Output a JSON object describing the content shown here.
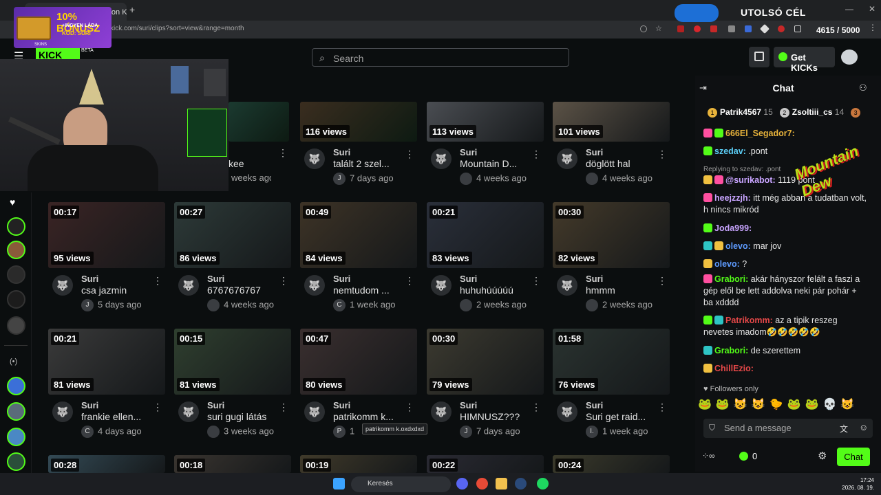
{
  "browser": {
    "tab_title": "Suri Clips - Watch Live on Kick",
    "url": "kick.com/suri/clips?sort=view&range=month",
    "new_tab": "+",
    "win_controls": [
      "—",
      "❐",
      "✕"
    ]
  },
  "overlay": {
    "banner_bonus": "10% BÓNUSZ",
    "banner_sub": "+INGYEN LÁDA",
    "banner_code": "KÓD: SURI",
    "banner_brand": "SKINS",
    "goal_label": "UTOLSÓ CÉL",
    "goal_value": "4615 / 5000",
    "brand_overlay": "Mountain Dew"
  },
  "header": {
    "logo": "KICK",
    "beta": "BETA",
    "search_placeholder": "Search",
    "get_kicks": "Get KICKs"
  },
  "clips": [
    {
      "duration": "",
      "views": "116 views",
      "author": "Suri",
      "title": "talált 2 szel...",
      "badge": "J",
      "ago": "7 days ago"
    },
    {
      "duration": "",
      "views": "113 views",
      "author": "Suri",
      "title": "Mountain D...",
      "badge": "",
      "ago": "4 weeks ago"
    },
    {
      "duration": "",
      "views": "101 views",
      "author": "Suri",
      "title": "döglött hal",
      "badge": "",
      "ago": "4 weeks ago"
    },
    {
      "duration": "00:17",
      "views": "95 views",
      "author": "Suri",
      "title": "csa jazmin",
      "badge": "J",
      "ago": "5 days ago"
    },
    {
      "duration": "00:27",
      "views": "86 views",
      "author": "Suri",
      "title": "6767676767",
      "badge": "",
      "ago": "4 weeks ago"
    },
    {
      "duration": "00:49",
      "views": "84 views",
      "author": "Suri",
      "title": "nemtudom ...",
      "badge": "C",
      "ago": "1 week ago"
    },
    {
      "duration": "00:21",
      "views": "83 views",
      "author": "Suri",
      "title": "huhuhúúúúú",
      "badge": "",
      "ago": "2 weeks ago"
    },
    {
      "duration": "00:30",
      "views": "82 views",
      "author": "Suri",
      "title": "hmmm",
      "badge": "",
      "ago": "2 weeks ago"
    },
    {
      "duration": "00:21",
      "views": "81 views",
      "author": "Suri",
      "title": "frankie ellen...",
      "badge": "C",
      "ago": "4 days ago"
    },
    {
      "duration": "00:15",
      "views": "81 views",
      "author": "Suri",
      "title": "suri gugi látás",
      "badge": "",
      "ago": "3 weeks ago"
    },
    {
      "duration": "00:47",
      "views": "80 views",
      "author": "Suri",
      "title": "patrikomm k...",
      "badge": "P",
      "ago": "1"
    },
    {
      "duration": "00:30",
      "views": "79 views",
      "author": "Suri",
      "title": "HIMNUSZ???",
      "badge": "J",
      "ago": "7 days ago"
    },
    {
      "duration": "01:58",
      "views": "76 views",
      "author": "Suri",
      "title": "Suri get raid...",
      "badge": "I.",
      "ago": "1 week ago"
    },
    {
      "duration": "00:28"
    },
    {
      "duration": "00:18"
    },
    {
      "duration": "00:19"
    },
    {
      "duration": "00:22"
    },
    {
      "duration": "00:24"
    }
  ],
  "partial_clip": {
    "title": "kee",
    "ago": "weeks ago"
  },
  "tooltip": "patrikomm k.oxdxdxd",
  "chat": {
    "title": "Chat",
    "leaders": [
      {
        "rank": "1",
        "name": "Patrik4567",
        "count": "15"
      },
      {
        "rank": "2",
        "name": "Zsoltiii_cs",
        "count": "14"
      },
      {
        "rank": "3",
        "name": "",
        "count": ""
      }
    ],
    "messages": [
      {
        "user": "666El_Segador7:",
        "text": "",
        "color": "#e8b33b"
      },
      {
        "user": "szedav:",
        "text": " .pont",
        "color": "#5ccff7"
      },
      {
        "reply": "Replying to szedav: .pont"
      },
      {
        "user": "@surikabot:",
        "text": " 1119 pont",
        "color": "#c8a4ff"
      },
      {
        "user": "heejzzjh:",
        "text": " itt még abban a tudatban volt, h nincs mikród",
        "color": "#c8a4ff"
      },
      {
        "user": "Joda999:",
        "text": "",
        "color": "#c8a4ff"
      },
      {
        "user": "olevo:",
        "text": " mar jov",
        "color": "#5e9bff"
      },
      {
        "user": "olevo:",
        "text": " ?",
        "color": "#5e9bff"
      },
      {
        "user": "Grabori:",
        "text": " akár hányszor felált a faszi a gép elől be lett addolva neki pár pohár + ba xdddd",
        "color": "#53fc18"
      },
      {
        "user": "Patrikomm:",
        "text": " az a tipik reszeg nevetes imadom🤣🤣🤣🤣🤣",
        "color": "#e64848"
      },
      {
        "user": "Grabori:",
        "text": " de szerettem",
        "color": "#53fc18"
      },
      {
        "user": "ChillEzio:",
        "text": "",
        "color": "#e64848"
      }
    ],
    "followers_only": "Followers only",
    "send_placeholder": "Send a message",
    "kicks_count": "0",
    "chat_button": "Chat"
  },
  "taskbar": {
    "search": "Keresés",
    "time": "17:24",
    "date": "2026. 08. 19."
  }
}
